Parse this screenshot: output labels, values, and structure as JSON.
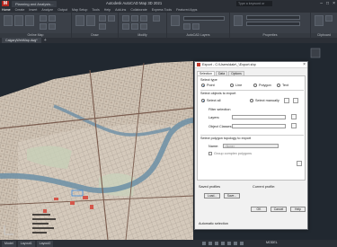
{
  "window": {
    "app_title": "Autodesk AutoCAD Map 3D 2021",
    "doc_tab": "Planning and Analysis...",
    "search_placeholder": "Type a keyword or phrase",
    "logo": "M"
  },
  "ribbon": {
    "tabs": [
      "Home",
      "Create",
      "Insert",
      "Analyze",
      "Output",
      "Map Setup",
      "Tools",
      "Help",
      "Add-ins",
      "Collaborate",
      "Express Tools",
      "Featured Apps"
    ],
    "active_tab": "Home",
    "panels": [
      "Online Map",
      "Draw",
      "Modify",
      "AutoCAD Layers",
      "Properties",
      "Clipboard"
    ]
  },
  "drawing_tab": "CalgaryWebMap.dwg*",
  "statusbar": {
    "tabs": [
      "Model",
      "Layout1",
      "Layout2"
    ],
    "model_label": "MODEL"
  },
  "dialog": {
    "title": "Export - C:\\Users\\dale\\_\\Export.shp",
    "close": "×",
    "tabs": [
      "Selection",
      "Data",
      "Options"
    ],
    "object_type_label": "Select type",
    "object_types": [
      "Point",
      "Line",
      "Polygon",
      "Text"
    ],
    "selected_type": "Point",
    "objects_label": "Select objects to export",
    "select_all": "Select all",
    "select_manually": "Select manually",
    "filter_label": "Filter selection",
    "layers_label": "Layers:",
    "feature_classes_label": "Object Classes:",
    "topology_label": "Select polygon topology to export",
    "name_label": "Name:",
    "name_value": "<None>",
    "group_complex": "Group complex polygons",
    "saved_profiles_label": "Saved profiles",
    "current_profile_label": "Current profile:",
    "load_button": "Load...",
    "save_button": "Save...",
    "ok_button": "OK",
    "cancel_button": "Cancel",
    "help_button": "Help",
    "automatic_selection": "Automatic selection"
  }
}
